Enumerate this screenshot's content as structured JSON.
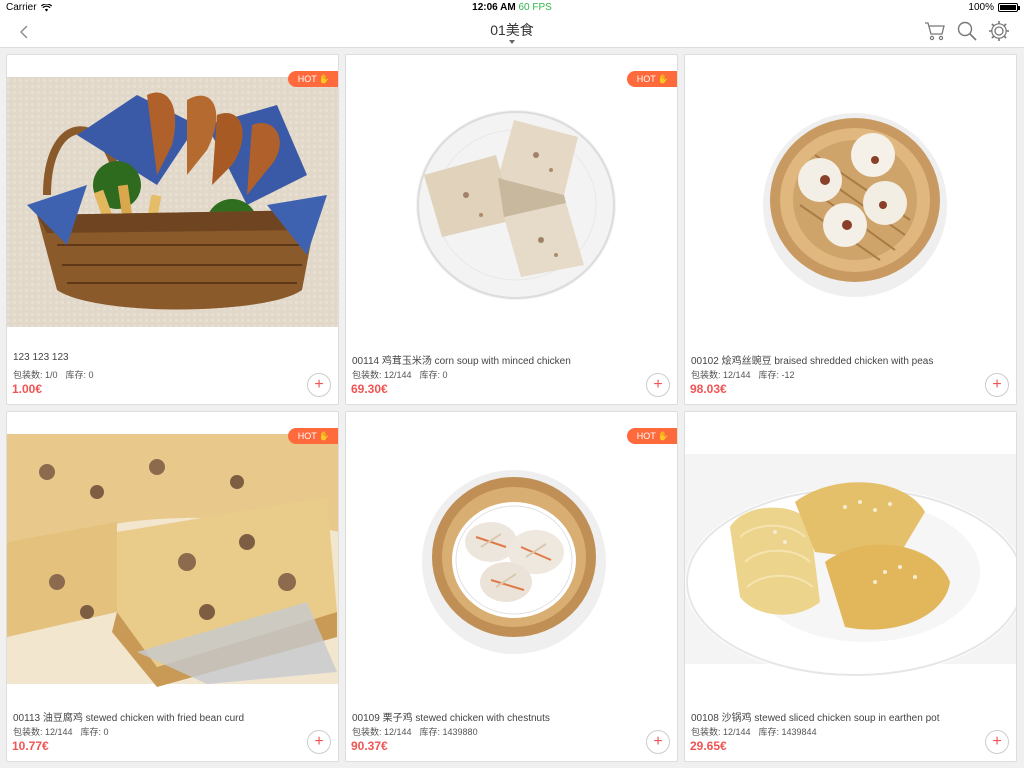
{
  "status": {
    "carrier": "Carrier",
    "time": "12:06 AM",
    "fps": "60 FPS",
    "battery": "100%"
  },
  "nav": {
    "title": "01美食"
  },
  "products": [
    {
      "name": "123 123 123",
      "pack_label": "包装数: 1/0",
      "stock_label": "库存: 0",
      "price": "1.00€",
      "hot": true,
      "hot_label": "HOT"
    },
    {
      "name": "00114 鸡茸玉米汤 corn soup with minced chicken",
      "pack_label": "包装数: 12/144",
      "stock_label": "库存: 0",
      "price": "69.30€",
      "hot": true,
      "hot_label": "HOT"
    },
    {
      "name": "00102 烩鸡丝豌豆 braised shredded chicken with peas",
      "pack_label": "包装数: 12/144",
      "stock_label": "库存: -12",
      "price": "98.03€",
      "hot": false,
      "hot_label": ""
    },
    {
      "name": "00113 油豆腐鸡 stewed chicken with fried bean curd",
      "pack_label": "包装数: 12/144",
      "stock_label": "库存: 0",
      "price": "10.77€",
      "hot": true,
      "hot_label": "HOT"
    },
    {
      "name": "00109 栗子鸡 stewed chicken with chestnuts",
      "pack_label": "包装数: 12/144",
      "stock_label": "库存: 1439880",
      "price": "90.37€",
      "hot": true,
      "hot_label": "HOT"
    },
    {
      "name": "00108 沙锅鸡 stewed sliced chicken soup in earthen pot",
      "pack_label": "包装数: 12/144",
      "stock_label": "库存: 1439844",
      "price": "29.65€",
      "hot": false,
      "hot_label": ""
    }
  ],
  "colors": {
    "accent": "#f05454",
    "hot": "#ff6a3d",
    "fps": "#2fb84a"
  },
  "icons": {
    "back": "chevron-left-icon",
    "cart": "cart-icon",
    "search": "search-icon",
    "settings": "gear-icon",
    "add": "plus-icon"
  }
}
